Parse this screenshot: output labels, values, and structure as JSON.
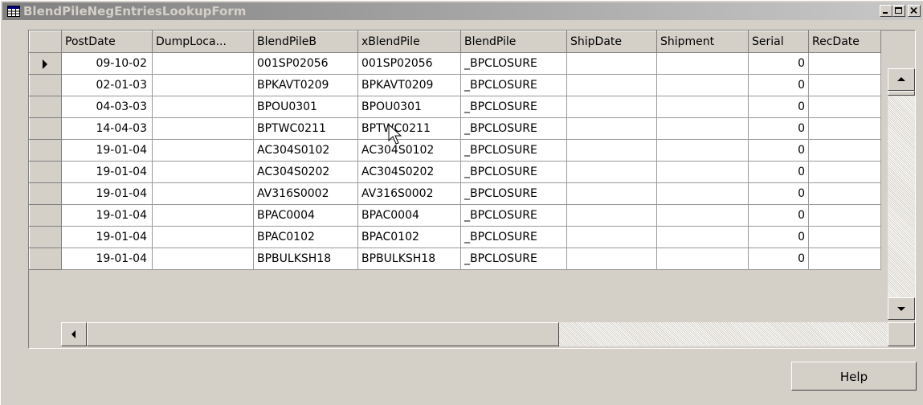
{
  "window": {
    "title": "BlendPileNegEntriesLookupForm"
  },
  "grid": {
    "columns": [
      "PostDate",
      "DumpLoca...",
      "BlendPileB",
      "xBlendPile",
      "BlendPile",
      "ShipDate",
      "Shipment",
      "Serial",
      "RecDate"
    ],
    "rows": [
      {
        "PostDate": "09-10-02",
        "DumpLocation": "",
        "BlendPileB": "001SP02056",
        "xBlendPile": "001SP02056",
        "BlendPile": "_BPCLOSURE",
        "ShipDate": "",
        "Shipment": "",
        "Serial": "0",
        "RecDate": "",
        "selected": true
      },
      {
        "PostDate": "02-01-03",
        "DumpLocation": "",
        "BlendPileB": "BPKAVT0209",
        "xBlendPile": "BPKAVT0209",
        "BlendPile": "_BPCLOSURE",
        "ShipDate": "",
        "Shipment": "",
        "Serial": "0",
        "RecDate": "",
        "selected": false
      },
      {
        "PostDate": "04-03-03",
        "DumpLocation": "",
        "BlendPileB": "BPOU0301",
        "xBlendPile": "BPOU0301",
        "BlendPile": "_BPCLOSURE",
        "ShipDate": "",
        "Shipment": "",
        "Serial": "0",
        "RecDate": "",
        "selected": false
      },
      {
        "PostDate": "14-04-03",
        "DumpLocation": "",
        "BlendPileB": "BPTWC0211",
        "xBlendPile": "BPTWC0211",
        "BlendPile": "_BPCLOSURE",
        "ShipDate": "",
        "Shipment": "",
        "Serial": "0",
        "RecDate": "",
        "selected": false
      },
      {
        "PostDate": "19-01-04",
        "DumpLocation": "",
        "BlendPileB": "AC304S0102",
        "xBlendPile": "AC304S0102",
        "BlendPile": "_BPCLOSURE",
        "ShipDate": "",
        "Shipment": "",
        "Serial": "0",
        "RecDate": "",
        "selected": false
      },
      {
        "PostDate": "19-01-04",
        "DumpLocation": "",
        "BlendPileB": "AC304S0202",
        "xBlendPile": "AC304S0202",
        "BlendPile": "_BPCLOSURE",
        "ShipDate": "",
        "Shipment": "",
        "Serial": "0",
        "RecDate": "",
        "selected": false
      },
      {
        "PostDate": "19-01-04",
        "DumpLocation": "",
        "BlendPileB": "AV316S0002",
        "xBlendPile": "AV316S0002",
        "BlendPile": "_BPCLOSURE",
        "ShipDate": "",
        "Shipment": "",
        "Serial": "0",
        "RecDate": "",
        "selected": false
      },
      {
        "PostDate": "19-01-04",
        "DumpLocation": "",
        "BlendPileB": "BPAC0004",
        "xBlendPile": "BPAC0004",
        "BlendPile": "_BPCLOSURE",
        "ShipDate": "",
        "Shipment": "",
        "Serial": "0",
        "RecDate": "",
        "selected": false
      },
      {
        "PostDate": "19-01-04",
        "DumpLocation": "",
        "BlendPileB": "BPAC0102",
        "xBlendPile": "BPAC0102",
        "BlendPile": "_BPCLOSURE",
        "ShipDate": "",
        "Shipment": "",
        "Serial": "0",
        "RecDate": "",
        "selected": false
      },
      {
        "PostDate": "19-01-04",
        "DumpLocation": "",
        "BlendPileB": "BPBULKSH18",
        "xBlendPile": "BPBULKSH18",
        "BlendPile": "_BPCLOSURE",
        "ShipDate": "",
        "Shipment": "",
        "Serial": "0",
        "RecDate": "",
        "selected": false
      }
    ]
  },
  "buttons": {
    "help_label": "Help"
  },
  "colors": {
    "face": "#d4d0c8",
    "title_start": "#808080",
    "title_end": "#c8c8c8",
    "cell_bg": "#ffffff"
  }
}
